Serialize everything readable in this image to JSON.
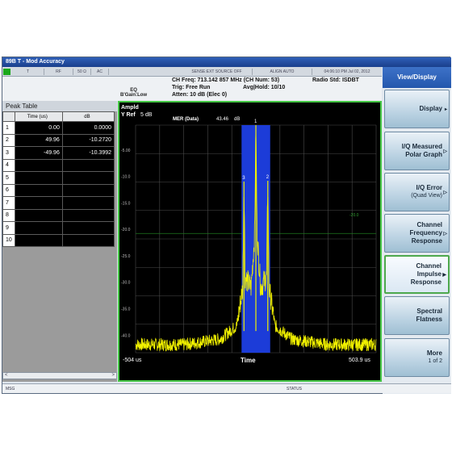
{
  "window": {
    "title": "89B T - Mod Accuracy"
  },
  "status_strip": {
    "cells": [
      "T",
      "RF",
      "50 Ω",
      "AC",
      "SENSE:EXT  SOURCE OFF",
      "ALIGN AUTO",
      "04:06:10 PM Jul 02, 2012"
    ]
  },
  "eq": {
    "line1": "EQ",
    "line2": "B'Gain:Low"
  },
  "measurement": {
    "ch_freq": "CH Freq: 713.142 857 MHz (CH Num: 53)",
    "trig": "Trig: Free Run",
    "avg_hold": "Avg|Hold: 10/10",
    "atten": "Atten: 10 dB (Elec 0)",
    "radio_std": "Radio Std: ISDBT"
  },
  "peak_table": {
    "title": "Peak Table",
    "headers": [
      "Time (us)",
      "dB"
    ],
    "rows": [
      {
        "index": "1",
        "time": "0.00",
        "db": "0.0000"
      },
      {
        "index": "2",
        "time": "49.96",
        "db": "-10.2720"
      },
      {
        "index": "3",
        "time": "-49.96",
        "db": "-10.3992"
      },
      {
        "index": "4",
        "time": "",
        "db": ""
      },
      {
        "index": "5",
        "time": "",
        "db": ""
      },
      {
        "index": "6",
        "time": "",
        "db": ""
      },
      {
        "index": "7",
        "time": "",
        "db": ""
      },
      {
        "index": "8",
        "time": "",
        "db": ""
      },
      {
        "index": "9",
        "time": "",
        "db": ""
      },
      {
        "index": "10",
        "time": "",
        "db": ""
      }
    ]
  },
  "plot": {
    "ampld_label": "Ampld",
    "yref_label": "Y Ref",
    "scale_label": "5 dB",
    "mer_label": "MER (Data)",
    "mer_value": "43.46",
    "mer_unit": "dB",
    "y_ticks": [
      "-5.00",
      "-10.0",
      "-15.0",
      "-20.0",
      "-25.0",
      "-30.0",
      "-35.0",
      "-40.0"
    ],
    "threshold_label": "-20.0",
    "x_start": "-504 us",
    "x_center": "Time",
    "x_end": "503.9 us",
    "markers": [
      "1",
      "2",
      "3"
    ],
    "chart_data": {
      "type": "line",
      "series": [
        {
          "values": [
            {
              "x": -504,
              "y": -40.5
            },
            {
              "x": -300,
              "y": -40.5
            },
            {
              "x": -150,
              "y": -39.5
            },
            {
              "x": -80,
              "y": -37
            },
            {
              "x": -55,
              "y": -30
            },
            {
              "x": -49.96,
              "y": -10.4
            },
            {
              "x": -45,
              "y": -28
            },
            {
              "x": -20,
              "y": -30
            },
            {
              "x": -5,
              "y": -20
            },
            {
              "x": 0,
              "y": 0
            },
            {
              "x": 5,
              "y": -20
            },
            {
              "x": 20,
              "y": -30
            },
            {
              "x": 45,
              "y": -28
            },
            {
              "x": 49.96,
              "y": -10.27
            },
            {
              "x": 55,
              "y": -30
            },
            {
              "x": 80,
              "y": -37
            },
            {
              "x": 150,
              "y": -39.5
            },
            {
              "x": 300,
              "y": -40.5
            },
            {
              "x": 503.9,
              "y": -40.5
            }
          ]
        }
      ],
      "xlim": [
        -504,
        503.9
      ],
      "ylim": [
        -42.0,
        0.0
      ],
      "threshold_y": -20.0,
      "highlight_band_x": [
        -60,
        60
      ],
      "grid": true,
      "colors": {
        "trace": "#f0f000",
        "band": "#1c3cd8",
        "threshold": "#1f7a1f",
        "grid": "#4a4a4a"
      }
    }
  },
  "softkeys": {
    "header": "View/Display",
    "items": [
      {
        "line1": "Display",
        "line2": "",
        "line3": ""
      },
      {
        "line1": "I/Q Measured",
        "line2": "Polar Graph",
        "line3": ""
      },
      {
        "line1": "I/Q Error",
        "line2": "(Quad View)",
        "line3": ""
      },
      {
        "line1": "Channel",
        "line2": "Frequency",
        "line3": "Response"
      },
      {
        "line1": "Channel",
        "line2": "Impulse",
        "line3": "Response"
      },
      {
        "line1": "Spectral",
        "line2": "Flatness",
        "line3": ""
      },
      {
        "line1": "More",
        "line2": "1 of 2",
        "line3": ""
      }
    ]
  },
  "msg_bar": {
    "left": "MSG",
    "center": "STATUS"
  }
}
